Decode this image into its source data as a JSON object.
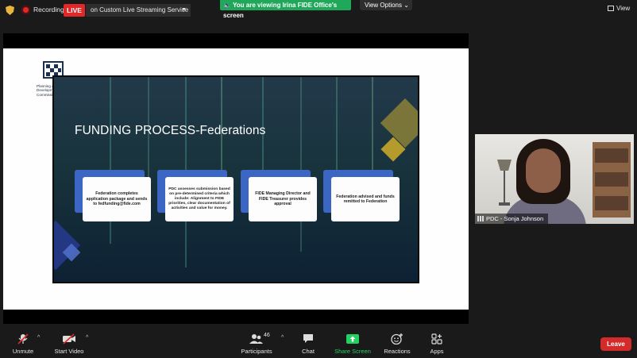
{
  "topbar": {
    "recording_label": "Recording",
    "live_badge": "LIVE",
    "stream_service": "on Custom Live Streaming Service",
    "viewing_banner": "You are viewing Irina FIDE Office's screen",
    "view_options_label": "View Options",
    "view_label": "View"
  },
  "slide": {
    "logo_text": "Planning and Development Commission",
    "title": "FUNDING PROCESS-Federations",
    "steps": [
      "Federation completes application package and sends to fedfunding@fide.com",
      "PDC assesses submission based on pre-determined criteria which include: Alignment to FIDE priorities, clear documentation of activities and value for money.",
      "FIDE Managing Director and FIDE Treasurer provides approval",
      "Federation advised and funds remitted to Federation"
    ]
  },
  "participant": {
    "name": "PDC - Sonja Johnson"
  },
  "toolbar": {
    "unmute": "Unmute",
    "start_video": "Start Video",
    "participants": "Participants",
    "participants_count": "46",
    "chat": "Chat",
    "share_screen": "Share Screen",
    "reactions": "Reactions",
    "apps": "Apps",
    "leave": "Leave"
  },
  "colors": {
    "accent_green": "#23d160",
    "leave_red": "#d32a2a",
    "live_red": "#e02828",
    "card_blue": "#3c66c4"
  }
}
